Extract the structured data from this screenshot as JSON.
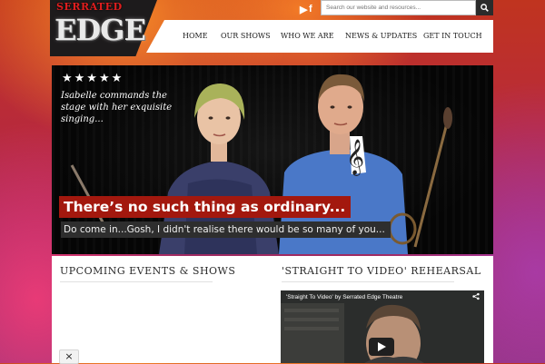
{
  "logo": {
    "top_text": "SERRATED",
    "main_text": "EDGE"
  },
  "header": {
    "social": [
      {
        "name": "youtube-icon",
        "glyph": "▶"
      },
      {
        "name": "facebook-icon",
        "glyph": "f"
      }
    ],
    "search": {
      "placeholder": "Search our website and resources...",
      "value": ""
    }
  },
  "nav": {
    "items": [
      "HOME",
      "OUR SHOWS",
      "WHO WE ARE",
      "NEWS & UPDATES",
      "GET IN TOUCH"
    ]
  },
  "hero": {
    "stars": "★★★★★",
    "rating": 5,
    "quote": "Isabelle commands the stage with her exquisite singing...",
    "headline": "There’s no such thing as ordinary...",
    "subline": "Do come in...Gosh, I didn't realise there would be so many of you..."
  },
  "sections": {
    "left_title": "UPCOMING EVENTS & SHOWS",
    "right_title": "'STRAIGHT TO VIDEO' REHEARSAL"
  },
  "video": {
    "title": "'Straight To Video' by Serrated Edge Theatre"
  },
  "close_button": {
    "label": "×"
  },
  "colors": {
    "accent_red": "#a3180e",
    "logo_dark": "#1d1b1c",
    "nav_bg": "#ffffff",
    "subline_bg": "#2e2e2e"
  }
}
